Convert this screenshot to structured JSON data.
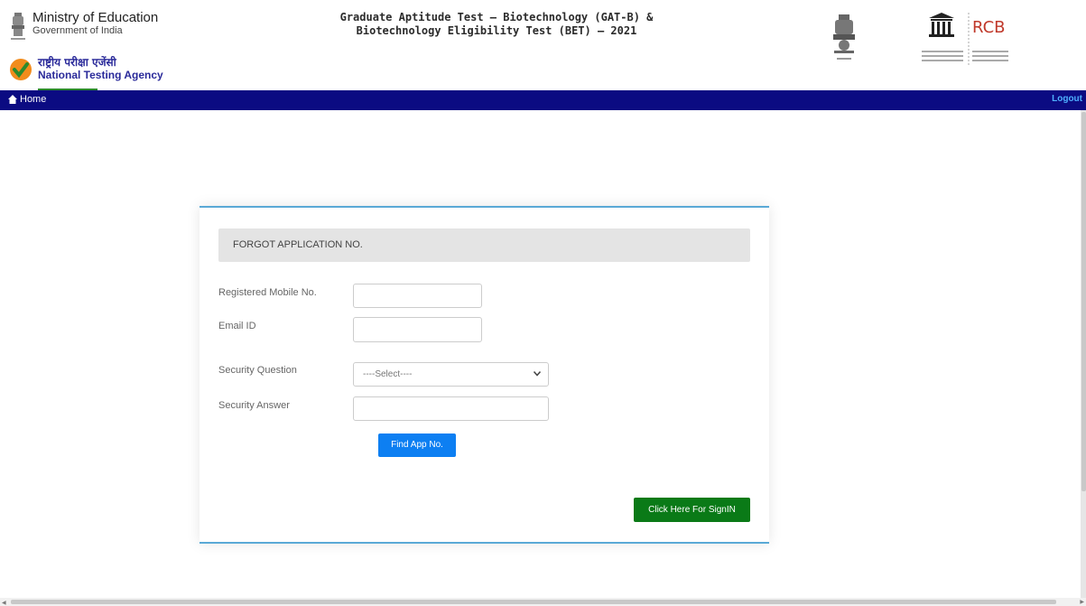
{
  "header": {
    "ministry_title": "Ministry of Education",
    "ministry_subtitle": "Government of India",
    "nta_hindi": "राष्ट्रीय परीक्षा एजेंसी",
    "nta_english": "National Testing Agency",
    "exam_title_line1": "Graduate Aptitude Test – Biotechnology (GAT-B) &",
    "exam_title_line2": "Biotechnology Eligibility Test (BET) – 2021",
    "logos": [
      "emblem-icon",
      "nta-check-icon",
      "unesco-icon",
      "rcb-logo"
    ]
  },
  "navbar": {
    "home_label": "Home",
    "logout_label": "Logout",
    "bg_color": "#0b0b82"
  },
  "form": {
    "heading": "FORGOT APPLICATION NO.",
    "mobile_label": "Registered Mobile No.",
    "mobile_value": "",
    "email_label": "Email ID",
    "email_value": "",
    "question_label": "Security Question",
    "question_selected": "----Select----",
    "answer_label": "Security Answer",
    "answer_value": "",
    "find_button": "Find App No.",
    "signin_button": "Click Here For SignIN"
  },
  "colors": {
    "primary_button": "#0d7ff2",
    "success_button": "#0a7a17",
    "card_border": "#5aa9d6"
  }
}
